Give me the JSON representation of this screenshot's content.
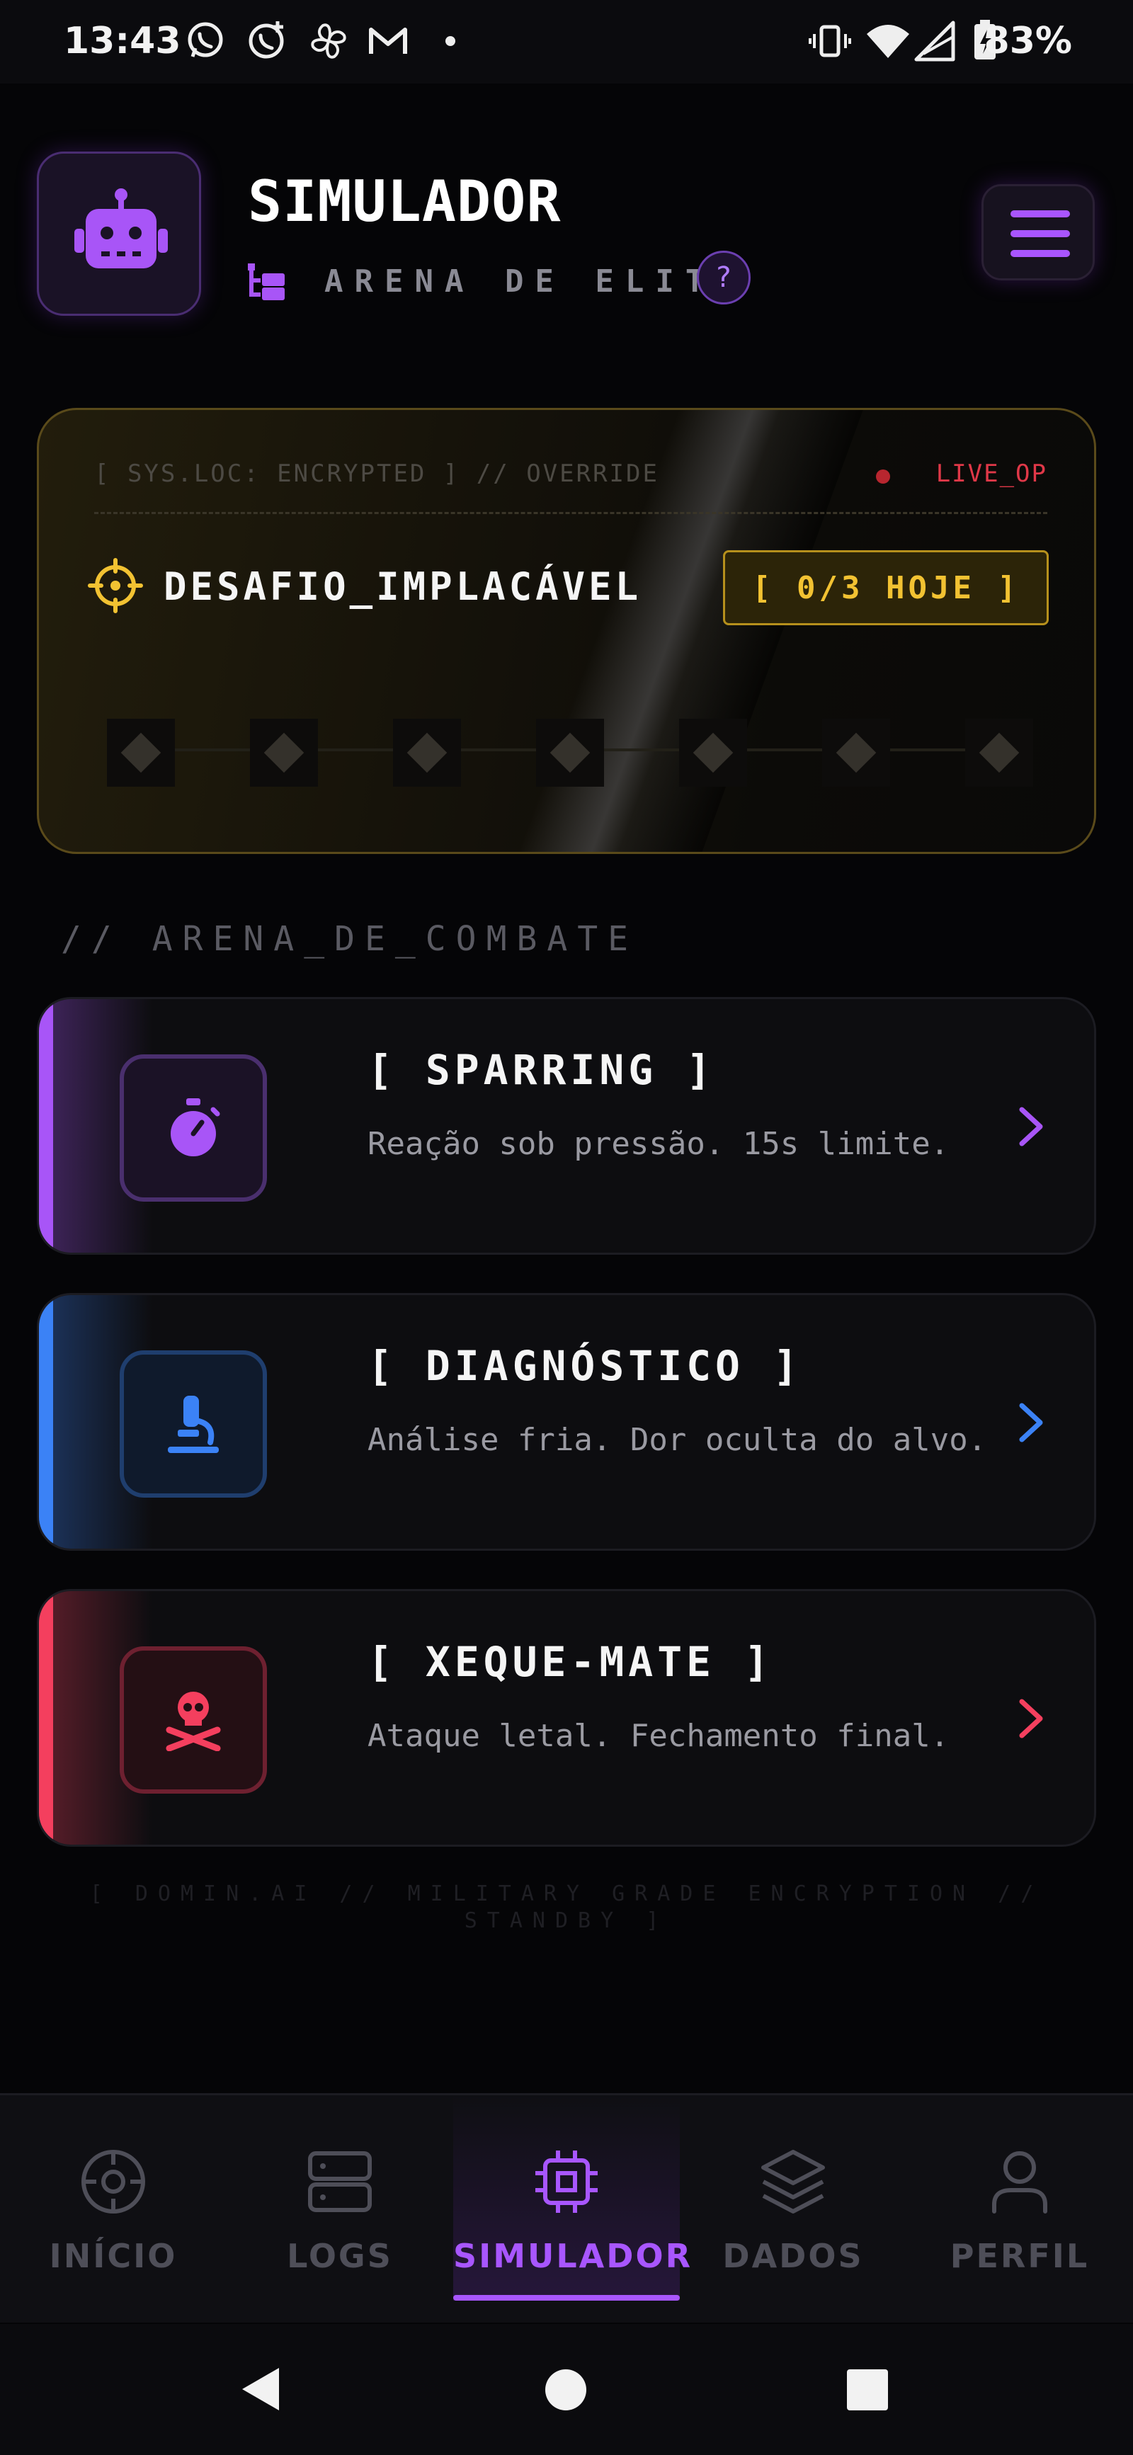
{
  "status_bar": {
    "time": "13:43",
    "left_icons": [
      "whatsapp-icon",
      "whatsapp-business-icon",
      "pinwheel-icon",
      "gmail-icon",
      "dot-icon"
    ],
    "right_icons": [
      "vibrate-icon",
      "wifi-icon",
      "signal-icon",
      "battery-charging-icon"
    ],
    "battery": "83%"
  },
  "header": {
    "logo_icon": "robot-icon",
    "title": "SIMULADOR",
    "subtitle_icon": "hierarchy-icon",
    "subtitle": "ARENA DE ELITE",
    "help_label": "?",
    "menu_icon": "hamburger-menu-icon"
  },
  "challenge": {
    "system_line": "[ SYS.LOC: ENCRYPTED ] // OVERRIDE",
    "live_label": "LIVE_OP",
    "target_icon": "crosshair-icon",
    "name": "DESAFIO_IMPLACÁVEL",
    "count_label": "[ 0/3 HOJE ]",
    "progress_nodes": 7,
    "accent_color": "#f2c232"
  },
  "section": {
    "title": "// ARENA_DE_COMBATE"
  },
  "modes": [
    {
      "title": "[ SPARRING ]",
      "description": "Reação sob pressão. 15s limite.",
      "icon": "stopwatch-icon",
      "color": "#a855f7"
    },
    {
      "title": "[ DIAGNÓSTICO ]",
      "description": "Análise fria. Dor oculta do alvo.",
      "icon": "microscope-icon",
      "color": "#3b82f6"
    },
    {
      "title": "[ XEQUE-MATE ]",
      "description": "Ataque letal. Fechamento final.",
      "icon": "skull-crossbones-icon",
      "color": "#f43f5e"
    }
  ],
  "footer": {
    "text": "[ DOMIN.AI // MILITARY GRADE ENCRYPTION // STANDBY ]"
  },
  "bottom_nav": {
    "items": [
      {
        "label": "INÍCIO",
        "icon": "target-icon"
      },
      {
        "label": "LOGS",
        "icon": "server-icon"
      },
      {
        "label": "SIMULADOR",
        "icon": "cpu-icon"
      },
      {
        "label": "DADOS",
        "icon": "layers-icon"
      },
      {
        "label": "PERFIL",
        "icon": "user-icon"
      }
    ],
    "active": "SIMULADOR"
  },
  "system_nav": {
    "icons": [
      "back-icon",
      "home-icon",
      "recents-icon"
    ]
  }
}
